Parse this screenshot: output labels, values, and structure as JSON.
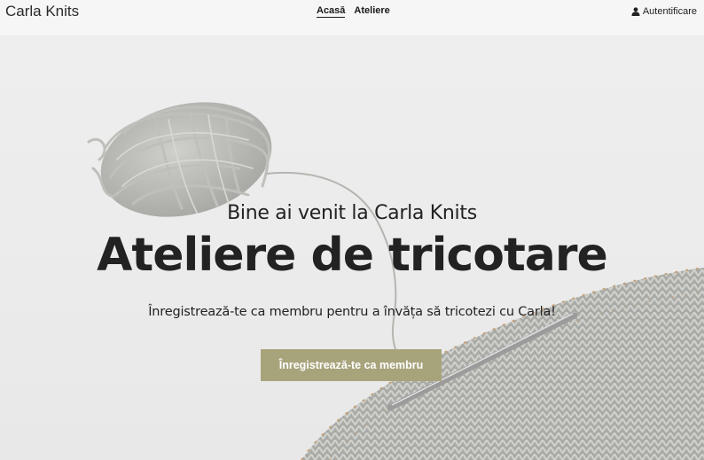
{
  "header": {
    "brand": "Carla Knits",
    "nav": [
      {
        "label": "Acasă",
        "active": true
      },
      {
        "label": "Ateliere",
        "active": false
      }
    ],
    "login_label": "Autentificare",
    "login_icon": "user-icon"
  },
  "hero": {
    "welcome": "Bine ai venit la Carla Knits",
    "headline": "Ateliere de tricotare",
    "subtitle": "Înregistrează-te ca membru pentru a învăța să tricotezi cu Carla!",
    "cta_label": "Înregistrează-te ca membru",
    "cta_color": "#a7a47c"
  }
}
